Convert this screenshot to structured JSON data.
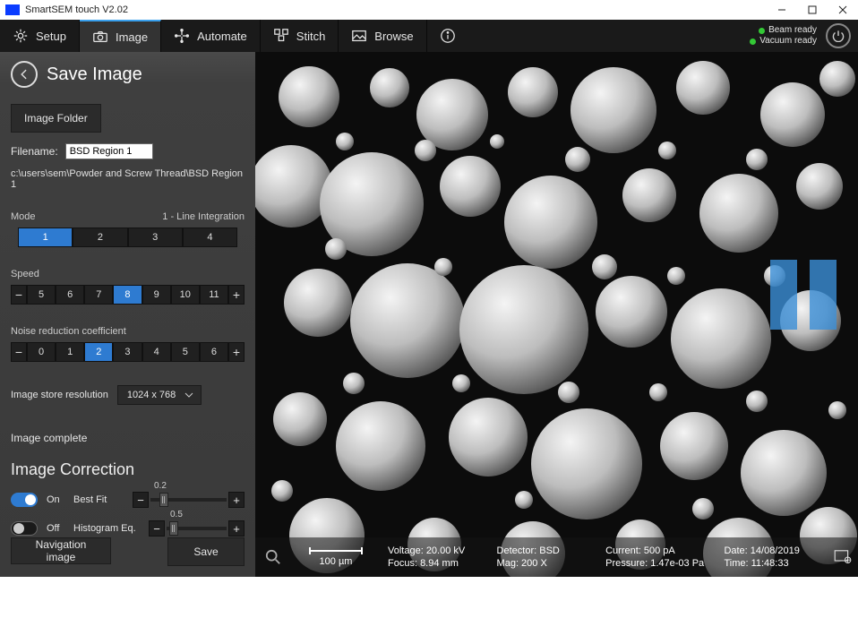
{
  "window": {
    "title": "SmartSEM touch V2.02"
  },
  "menu": {
    "items": [
      {
        "label": "Setup",
        "icon": "gear-icon"
      },
      {
        "label": "Image",
        "icon": "camera-icon",
        "active": true
      },
      {
        "label": "Automate",
        "icon": "automate-icon"
      },
      {
        "label": "Stitch",
        "icon": "stitch-icon"
      },
      {
        "label": "Browse",
        "icon": "picture-icon"
      }
    ],
    "status": {
      "beam": "Beam ready",
      "vacuum": "Vacuum ready"
    }
  },
  "panel": {
    "title": "Save Image",
    "image_folder_btn": "Image Folder",
    "filename_label": "Filename:",
    "filename_value": "BSD Region 1",
    "path": "c:\\users\\sem\\Powder and Screw Thread\\BSD Region 1",
    "mode": {
      "label": "Mode",
      "value_label": "1 - Line Integration",
      "options": [
        "1",
        "2",
        "3",
        "4"
      ],
      "active": "1"
    },
    "speed": {
      "label": "Speed",
      "options": [
        "5",
        "6",
        "7",
        "8",
        "9",
        "10",
        "11"
      ],
      "active": "8"
    },
    "noise": {
      "label": "Noise reduction coefficient",
      "options": [
        "0",
        "1",
        "2",
        "3",
        "4",
        "5",
        "6"
      ],
      "active": "2"
    },
    "resolution": {
      "label": "Image store resolution",
      "value": "1024 x 768"
    },
    "complete": "Image complete",
    "correction": {
      "title": "Image Correction",
      "bestfit": {
        "on_label": "On",
        "name": "Best Fit",
        "value": "0.2"
      },
      "histeq": {
        "off_label": "Off",
        "name": "Histogram Eq.",
        "value": "0.5"
      }
    },
    "nav_btn": "Navigation image",
    "save_btn": "Save"
  },
  "statusbar": {
    "scale": "100 µm",
    "voltage": "Voltage: 20.00 kV",
    "detector": "Detector: BSD",
    "current": "Current: 500 pA",
    "date": "Date: 14/08/2019",
    "focus": "Focus: 8.94 mm",
    "mag": "Mag: 200 X",
    "pressure": "Pressure: 1.47e-03 Pa",
    "time": "Time: 11:48:33"
  }
}
